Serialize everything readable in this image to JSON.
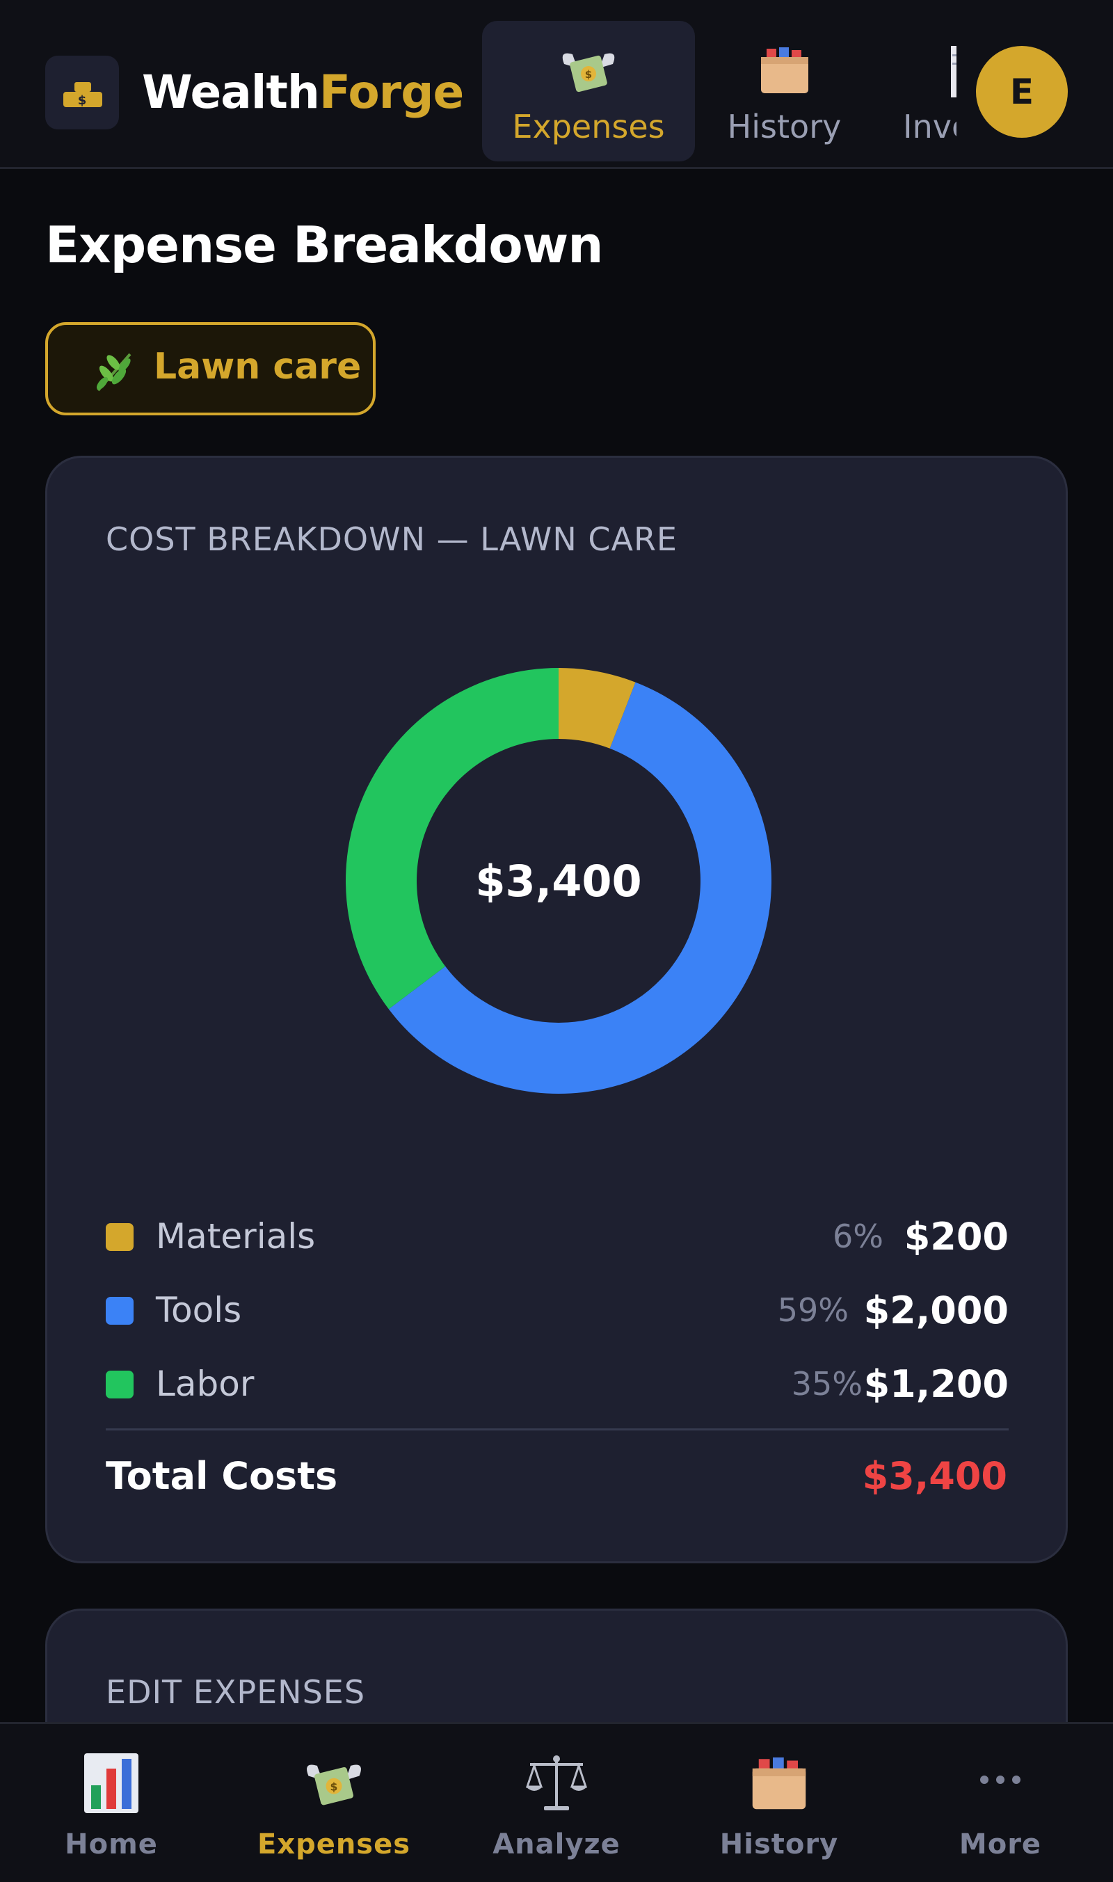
{
  "header": {
    "brand_part1": "Wealth",
    "brand_part2": "Forge",
    "logo_icon": "gold-bars-icon",
    "nav_tabs": [
      {
        "label": "Expenses",
        "icon": "money-with-wings-icon",
        "active": true
      },
      {
        "label": "History",
        "icon": "card-file-box-icon",
        "active": false
      },
      {
        "label": "Invc",
        "icon": "receipt-icon",
        "active": false
      }
    ],
    "avatar_initial": "E"
  },
  "page": {
    "title": "Expense Breakdown",
    "category_chip": {
      "icon": "herb-icon",
      "label": "Lawn care"
    }
  },
  "breakdown": {
    "heading": "COST BREAKDOWN — LAWN CARE",
    "center_total": "$3,400",
    "items": [
      {
        "name": "Materials",
        "pct": "6%",
        "value": "$200"
      },
      {
        "name": "Tools",
        "pct": "59%",
        "value": "$2,000"
      },
      {
        "name": "Labor",
        "pct": "35%",
        "value": "$1,200"
      }
    ],
    "total_label": "Total Costs",
    "total_value": "$3,400"
  },
  "chart_data": {
    "type": "pie",
    "variant": "donut",
    "categories": [
      "Materials",
      "Tools",
      "Labor"
    ],
    "values": [
      200,
      2000,
      1200
    ],
    "colors": [
      "#d4a72c",
      "#3b82f6",
      "#22c55e"
    ],
    "center_label": "$3,400"
  },
  "edit": {
    "heading": "EDIT EXPENSES"
  },
  "bottom_nav": [
    {
      "label": "Home",
      "icon": "bar-chart-icon",
      "active": false
    },
    {
      "label": "Expenses",
      "icon": "money-with-wings-icon",
      "active": true
    },
    {
      "label": "Analyze",
      "icon": "balance-scale-icon",
      "active": false
    },
    {
      "label": "History",
      "icon": "card-file-box-icon",
      "active": false
    },
    {
      "label": "More",
      "icon": "more-dots-icon",
      "active": false
    }
  ],
  "colors": {
    "accent": "#d4a72c",
    "background": "#0a0b0f",
    "card": "#1e2030",
    "negative": "#ef4444"
  }
}
